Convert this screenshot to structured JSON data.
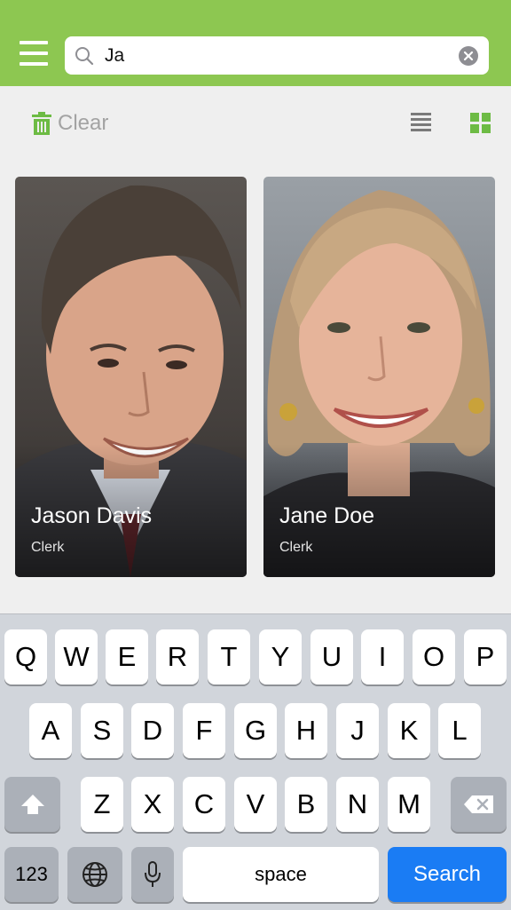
{
  "header": {
    "search": {
      "value": "Ja",
      "placeholder": ""
    },
    "accent_color": "#8dc751"
  },
  "toolbar": {
    "clear_label": "Clear",
    "view_modes": [
      "list-icon",
      "grid-icon"
    ],
    "active_view": "grid"
  },
  "people": [
    {
      "name": "Jason Davis",
      "role": "Clerk"
    },
    {
      "name": "Jane Doe",
      "role": "Clerk"
    }
  ],
  "keyboard": {
    "row1": [
      "Q",
      "W",
      "E",
      "R",
      "T",
      "Y",
      "U",
      "I",
      "O",
      "P"
    ],
    "row2": [
      "A",
      "S",
      "D",
      "F",
      "G",
      "H",
      "J",
      "K",
      "L"
    ],
    "row3": [
      "Z",
      "X",
      "C",
      "V",
      "B",
      "N",
      "M"
    ],
    "numbers_label": "123",
    "space_label": "space",
    "search_label": "Search"
  }
}
